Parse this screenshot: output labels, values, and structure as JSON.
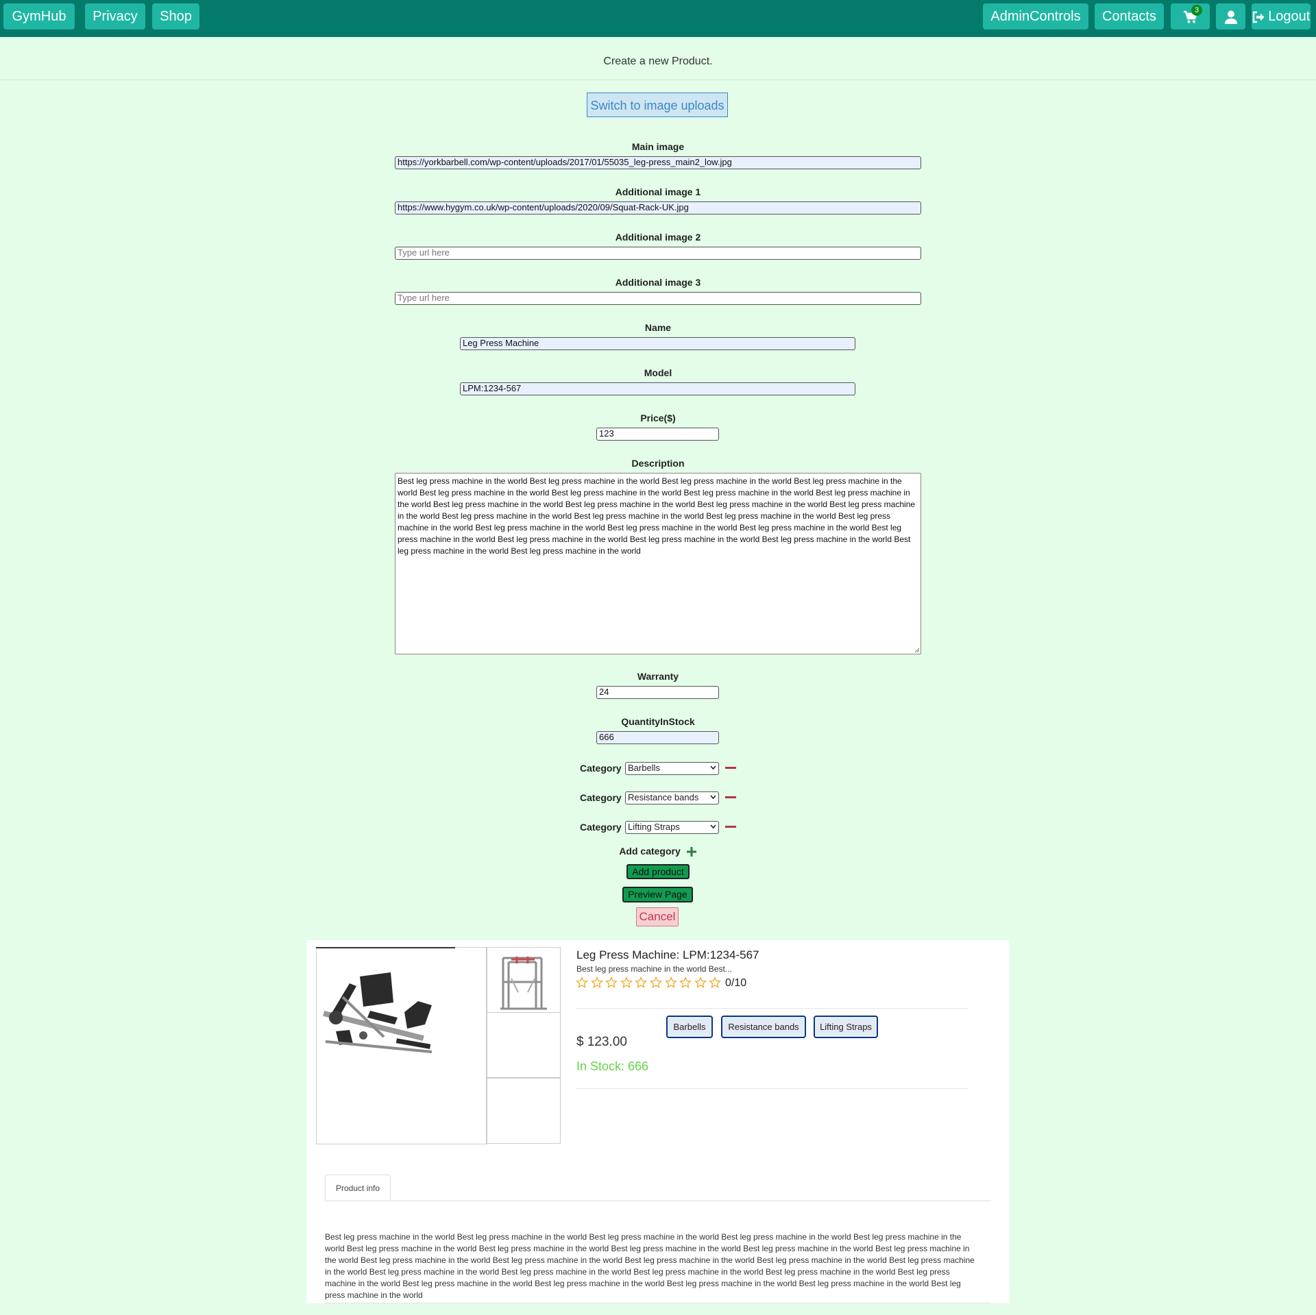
{
  "navbar": {
    "brand": "GymHub",
    "links": [
      "Privacy",
      "Shop"
    ],
    "right": {
      "admin": "AdminControls",
      "contacts": "Contacts",
      "cart_count": "3",
      "logout": "Logout"
    }
  },
  "form": {
    "heading": "Create a new Product.",
    "switch_button": "Switch to image uploads",
    "main_image": {
      "label": "Main image",
      "value": "https://yorkbarbell.com/wp-content/uploads/2017/01/55035_leg-press_main2_low.jpg"
    },
    "additional_image_1": {
      "label": "Additional image 1",
      "value": "https://www.hygym.co.uk/wp-content/uploads/2020/09/Squat-Rack-UK.jpg"
    },
    "additional_image_2": {
      "label": "Additional image 2",
      "placeholder": "Type url here"
    },
    "additional_image_3": {
      "label": "Additional image 3",
      "placeholder": "Type url here"
    },
    "name": {
      "label": "Name",
      "value": "Leg Press Machine"
    },
    "model": {
      "label": "Model",
      "value": "LPM:1234-567"
    },
    "price": {
      "label": "Price($)",
      "value": "123"
    },
    "description": {
      "label": "Description",
      "value": "Best leg press machine in the world Best leg press machine in the world Best leg press machine in the world Best leg press machine in the world Best leg press machine in the world Best leg press machine in the world Best leg press machine in the world Best leg press machine in the world Best leg press machine in the world Best leg press machine in the world Best leg press machine in the world Best leg press machine in the world Best leg press machine in the world Best leg press machine in the world Best leg press machine in the world Best leg press machine in the world Best leg press machine in the world Best leg press machine in the world Best leg press machine in the world Best leg press machine in the world Best leg press machine in the world Best leg press machine in the world Best leg press machine in the world Best leg press machine in the world Best leg press machine in the world"
    },
    "warranty": {
      "label": "Warranty",
      "value": "24"
    },
    "quantity": {
      "label": "QuantityInStock",
      "value": "666"
    },
    "categories": [
      {
        "label": "Category",
        "value": "Barbells"
      },
      {
        "label": "Category",
        "value": "Resistance bands"
      },
      {
        "label": "Category",
        "value": "Lifting Straps"
      }
    ],
    "add_category": "Add category",
    "add_product": "Add product",
    "preview_page": "Preview Page",
    "cancel": "Cancel"
  },
  "preview": {
    "title": "Leg Press Machine: LPM:1234-567",
    "short_desc": "Best leg press machine in the world Best...",
    "rating_text": "0/10",
    "rating_value": 0,
    "rating_max": 10,
    "tags": [
      "Barbells",
      "Resistance bands",
      "Lifting Straps"
    ],
    "price": "$ 123.00",
    "stock": "In Stock: 666",
    "tab_label": "Product info",
    "info": "Best leg press machine in the world Best leg press machine in the world Best leg press machine in the world Best leg press machine in the world Best leg press machine in the world Best leg press machine in the world Best leg press machine in the world Best leg press machine in the world Best leg press machine in the world Best leg press machine in the world Best leg press machine in the world Best leg press machine in the world Best leg press machine in the world Best leg press machine in the world Best leg press machine in the world Best leg press machine in the world Best leg press machine in the world Best leg press machine in the world Best leg press machine in the world Best leg press machine in the world Best leg press machine in the world Best leg press machine in the world Best leg press machine in the world Best leg press machine in the world Best leg press machine in the world"
  },
  "colors": {
    "navbar": "#047a6a",
    "nav_button": "#1fb7a4",
    "page_background": "#e3fde8",
    "accent_green": "#109c50",
    "remove_red": "#b8343e",
    "stock_green": "#66d34a"
  },
  "icons": [
    "cart-icon",
    "user-icon",
    "logout-icon",
    "minus-icon",
    "plus-icon",
    "star-icon",
    "chevron-down-icon"
  ]
}
